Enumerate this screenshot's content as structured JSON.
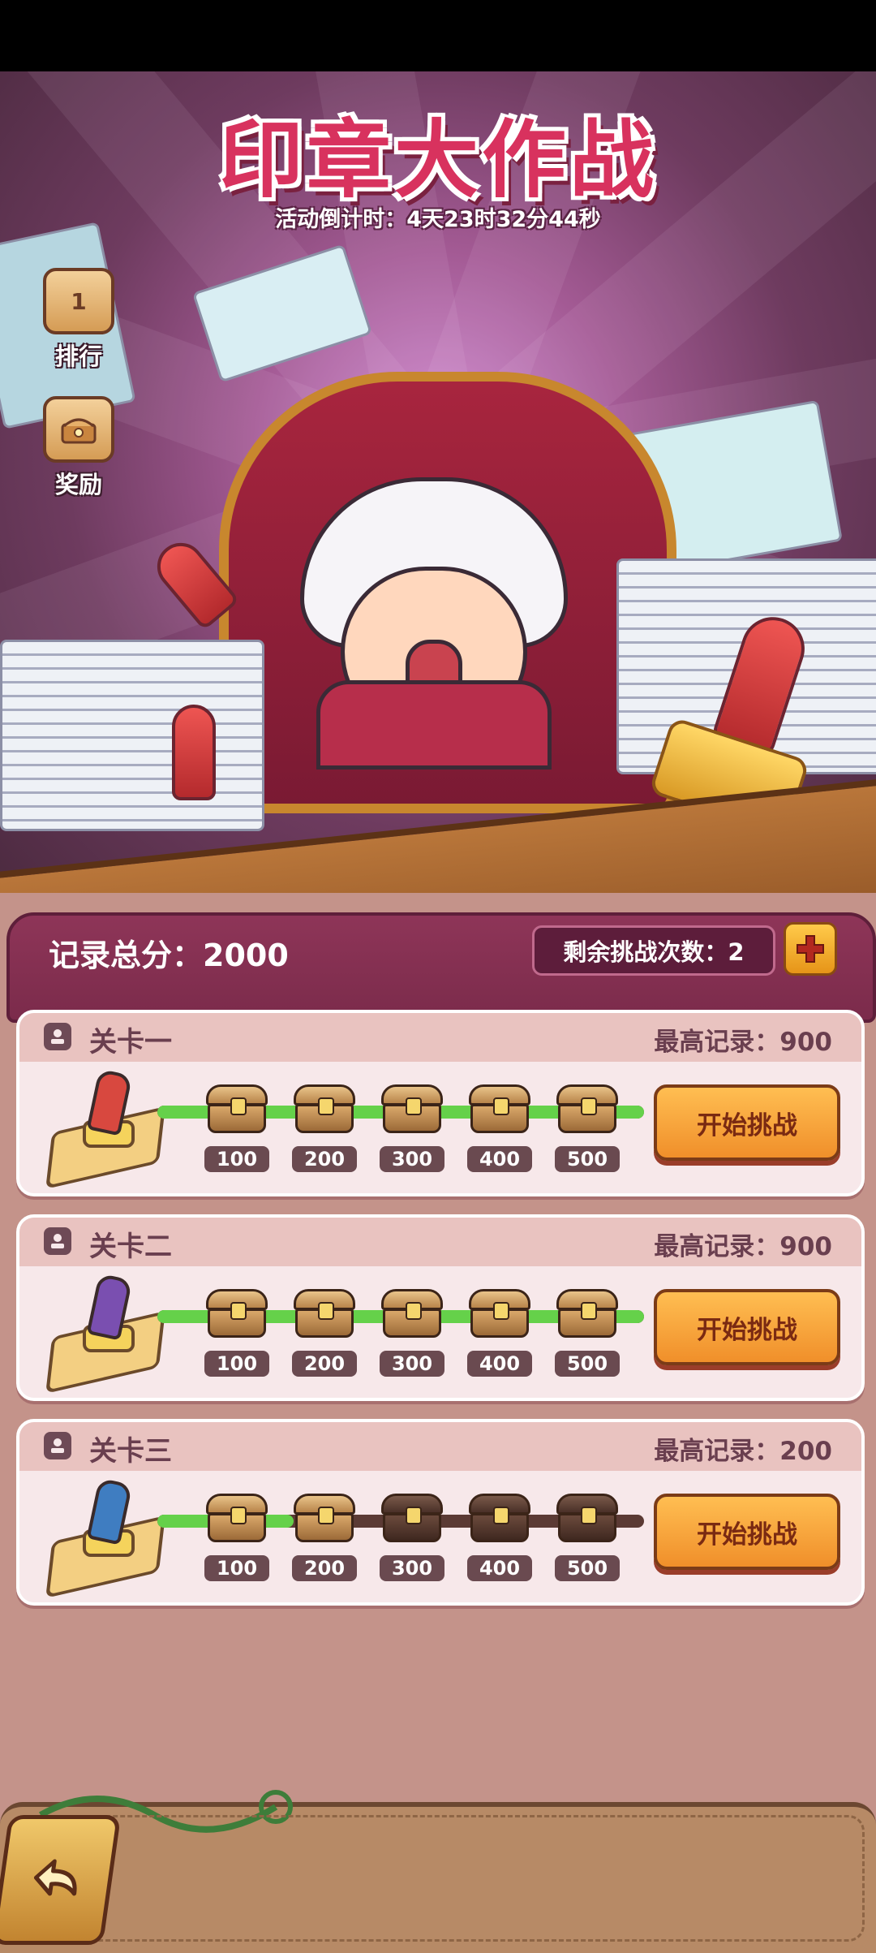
{
  "event": {
    "title": "印章大作战",
    "countdown": "活动倒计时：4天23时32分44秒"
  },
  "side_menu": {
    "rank": {
      "label": "排行",
      "badge": "1",
      "icon": "trophy-icon"
    },
    "reward": {
      "label": "奖励",
      "icon": "reward-chest-icon"
    }
  },
  "summary": {
    "total_score": "记录总分：2000",
    "attempts": "剩余挑战次数：2",
    "add_icon": "plus-icon"
  },
  "levels": [
    {
      "name": "关卡一",
      "best": "最高记录：900",
      "button": "开始挑战",
      "stamp_color": "#d8483f",
      "progress": 1.0,
      "chests": [
        {
          "threshold": "100",
          "state": "closed"
        },
        {
          "threshold": "200",
          "state": "closed"
        },
        {
          "threshold": "300",
          "state": "closed"
        },
        {
          "threshold": "400",
          "state": "closed"
        },
        {
          "threshold": "500",
          "state": "closed"
        }
      ]
    },
    {
      "name": "关卡二",
      "best": "最高记录：900",
      "button": "开始挑战",
      "stamp_color": "#7a4fb0",
      "progress": 1.0,
      "chests": [
        {
          "threshold": "100",
          "state": "closed"
        },
        {
          "threshold": "200",
          "state": "closed"
        },
        {
          "threshold": "300",
          "state": "closed"
        },
        {
          "threshold": "400",
          "state": "closed"
        },
        {
          "threshold": "500",
          "state": "closed"
        }
      ]
    },
    {
      "name": "关卡三",
      "best": "最高记录：200",
      "button": "开始挑战",
      "stamp_color": "#3f7dc1",
      "progress": 0.28,
      "chests": [
        {
          "threshold": "100",
          "state": "closed"
        },
        {
          "threshold": "200",
          "state": "closed"
        },
        {
          "threshold": "300",
          "state": "locked"
        },
        {
          "threshold": "400",
          "state": "locked"
        },
        {
          "threshold": "500",
          "state": "locked"
        }
      ]
    }
  ],
  "nav": {
    "back_icon": "back-arrow-icon"
  }
}
